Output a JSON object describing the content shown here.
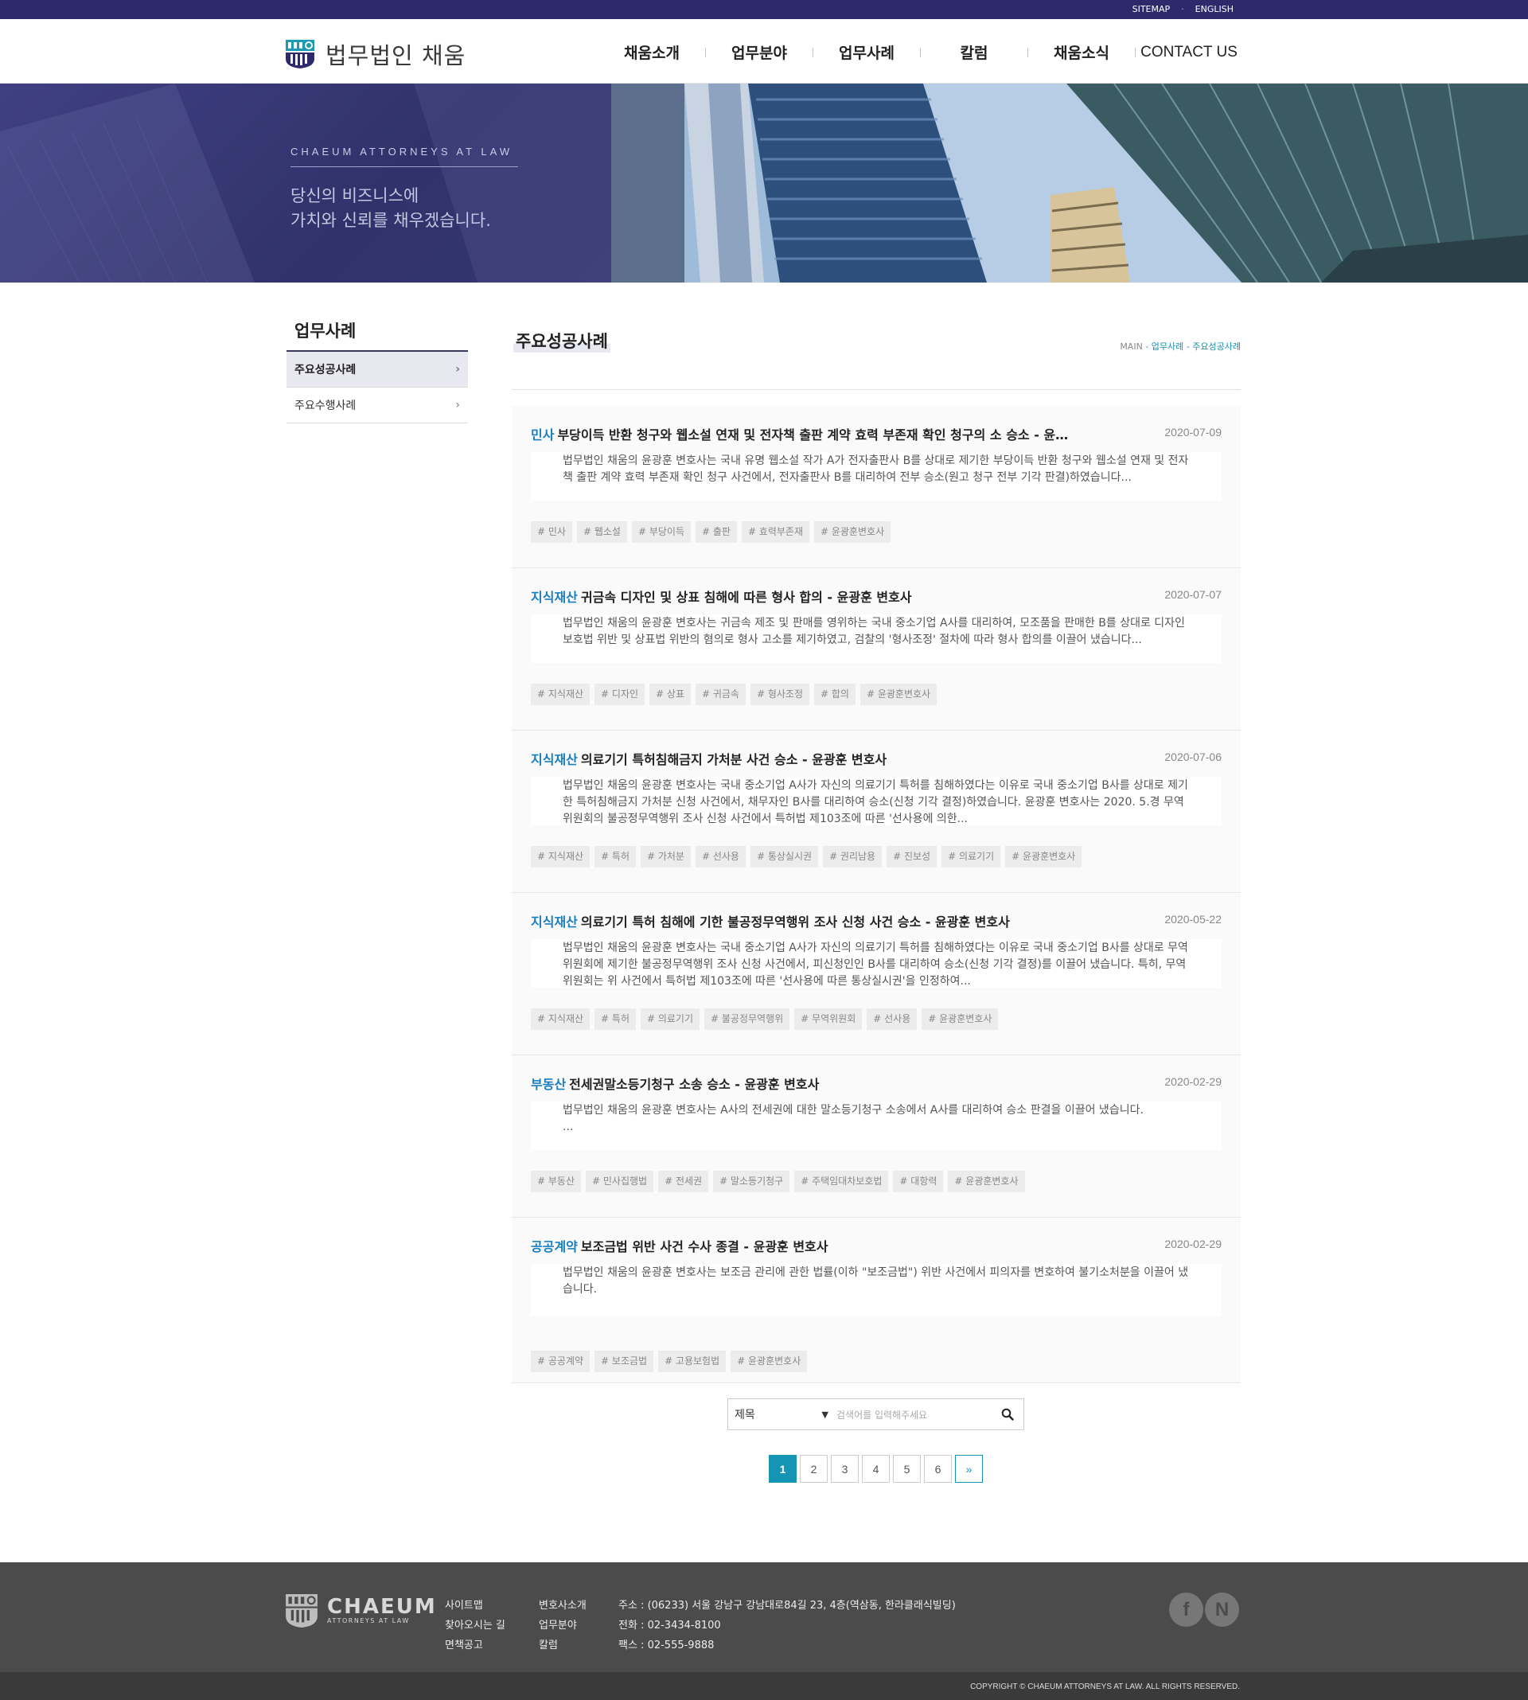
{
  "topbar": {
    "links": [
      "SITEMAP",
      "ENGLISH"
    ]
  },
  "header": {
    "logo_text": "법무법인 채움",
    "nav": [
      "채움소개",
      "업무분야",
      "업무사례",
      "칼럼",
      "채움소식",
      "CONTACT US"
    ]
  },
  "hero": {
    "tagline": "CHAEUM ATTORNEYS AT LAW",
    "slogan_line1": "당신의 비즈니스에",
    "slogan_line2": "가치와 신뢰를 채우겠습니다."
  },
  "sidebar": {
    "title": "업무사례",
    "items": [
      {
        "label": "주요성공사례",
        "active": true
      },
      {
        "label": "주요수행사례",
        "active": false
      }
    ]
  },
  "content": {
    "page_title": "주요성공사례",
    "breadcrumb": {
      "main": "MAIN",
      "sep": "-",
      "section": "업무사례",
      "current": "주요성공사례"
    }
  },
  "posts": [
    {
      "category": "민사",
      "title": "부당이득 반환 청구와 웹소설 연재 및 전자책 출판 계약 효력 부존재 확인 청구의 소 승소 - 윤…",
      "date": "2020-07-09",
      "summary": "법무법인 채움의 윤광훈 변호사는 국내 유명 웹소설 작가 A가 전자출판사 B를 상대로 제기한 부당이득 반환 청구와 웹소설 연재 및 전자책 출판 계약 효력 부존재 확인 청구 사건에서, 전자출판사 B를 대리하여 전부 승소(원고 청구 전부 기각 판결)하였습니다...",
      "tags": [
        "# 민사",
        "# 웹소설",
        "# 부당이득",
        "# 출판",
        "# 효력부존재",
        "# 윤광훈변호사"
      ]
    },
    {
      "category": "지식재산",
      "title": "귀금속 디자인 및 상표 침해에 따른 형사 합의 - 윤광훈 변호사",
      "date": "2020-07-07",
      "summary": "법무법인 채움의 윤광훈 변호사는 귀금속 제조 및 판매를 영위하는 국내 중소기업 A사를 대리하여, 모조품을 판매한 B를 상대로 디자인보호법 위반 및 상표법 위반의 혐의로 형사 고소를 제기하였고, 검찰의 '형사조정' 절차에 따라 형사 합의를 이끌어 냈습니다...",
      "tags": [
        "# 지식재산",
        "# 디자인",
        "# 상표",
        "# 귀금속",
        "# 형사조정",
        "# 합의",
        "# 윤광훈변호사"
      ]
    },
    {
      "category": "지식재산",
      "title": "의료기기 특허침해금지 가처분 사건 승소 - 윤광훈 변호사",
      "date": "2020-07-06",
      "summary": "법무법인 채움의 윤광훈 변호사는 국내 중소기업 A사가 자신의 의료기기 특허를 침해하였다는 이유로 국내 중소기업 B사를 상대로 제기한 특허침해금지 가처분 신청 사건에서, 채무자인 B사를 대리하여 승소(신청 기각 결정)하였습니다. 윤광훈 변호사는 2020. 5.경 무역위원회의 불공정무역행위 조사 신청 사건에서 특허법 제103조에 따른 '선사용에 의한...",
      "tags": [
        "# 지식재산",
        "# 특허",
        "# 가처분",
        "# 선사용",
        "# 통상실시권",
        "# 권리남용",
        "# 진보성",
        "# 의료기기",
        "# 윤광훈변호사"
      ]
    },
    {
      "category": "지식재산",
      "title": "의료기기 특허 침해에 기한 불공정무역행위 조사 신청 사건 승소 - 윤광훈 변호사",
      "date": "2020-05-22",
      "summary": "법무법인 채움의 윤광훈 변호사는 국내 중소기업 A사가 자신의 의료기기 특허를 침해하였다는 이유로 국내 중소기업 B사를 상대로 무역위원회에 제기한 불공정무역행위 조사 신청 사건에서, 피신청인인 B사를 대리하여 승소(신청 기각 결정)를 이끌어 냈습니다. 특히, 무역위원회는 위 사건에서 특허법 제103조에 따른 '선사용에 따른 통상실시권'을 인정하여...",
      "tags": [
        "# 지식재산",
        "# 특허",
        "# 의료기기",
        "# 불공정무역행위",
        "# 무역위원회",
        "# 선사용",
        "# 윤광훈변호사"
      ]
    },
    {
      "category": "부동산",
      "title": "전세권말소등기청구 소송 승소 - 윤광훈 변호사",
      "date": "2020-02-29",
      "summary": "법무법인 채움의 윤광훈 변호사는 A사의 전세권에 대한 말소등기청구 소송에서 A사를 대리하여 승소 판결을 이끌어 냈습니다.\n...",
      "tags": [
        "# 부동산",
        "# 민사집행법",
        "# 전세권",
        "# 말소등기청구",
        "# 주택임대차보호법",
        "# 대항력",
        "# 윤광훈변호사"
      ]
    },
    {
      "category": "공공계약",
      "title": "보조금법 위반 사건 수사 종결 - 윤광훈 변호사",
      "date": "2020-02-29",
      "summary": "법무법인 채움의 윤광훈 변호사는 보조금 관리에 관한 법률(이하 \"보조금법\") 위반 사건에서 피의자를 변호하여 불기소처분을 이끌어 냈습니다.",
      "tags": [
        "# 공공계약",
        "# 보조금법",
        "# 고용보험법",
        "# 윤광훈변호사"
      ]
    }
  ],
  "search": {
    "select_value": "제목",
    "placeholder": "검색어를 입력해주세요"
  },
  "pagination": {
    "pages": [
      "1",
      "2",
      "3",
      "4",
      "5",
      "6"
    ],
    "current": "1",
    "next": "»"
  },
  "footer": {
    "logo_big": "CHAEUM",
    "logo_small": "ATTORNEYS AT LAW",
    "col1": [
      "사이트맵",
      "찾아오시는 길",
      "면책공고"
    ],
    "col2": [
      "변호사소개",
      "업무분야",
      "칼럼"
    ],
    "address": "주소 : (06233) 서울 강남구 강남대로84길 23, 4층(역삼동, 한라클래식빌딩)",
    "phone": "전화 : 02-3434-8100",
    "fax": "팩스 : 02-555-9888",
    "sns": [
      "f",
      "N"
    ],
    "copyright": "COPYRIGHT © CHAEUM ATTORNEYS AT LAW. ALL RIGHTS RESERVED."
  },
  "colors": {
    "navy": "#2c2a6b",
    "accent": "#1594b4",
    "category_blue": "#1a7fbf",
    "footer_bg": "#4b4b4b"
  }
}
